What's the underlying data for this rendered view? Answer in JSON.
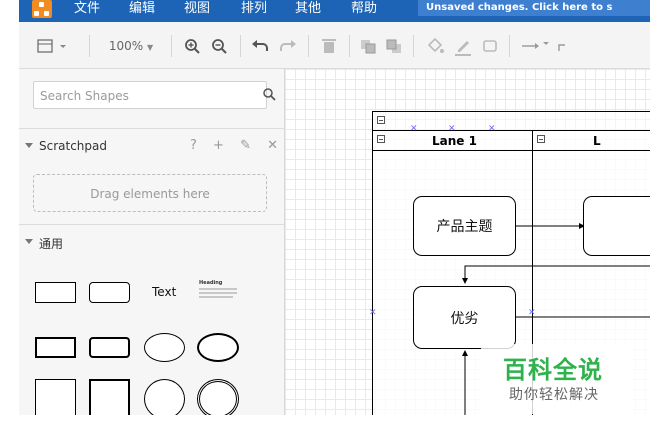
{
  "menubar": {
    "items": [
      "文件",
      "编辑",
      "视图",
      "排列",
      "其他",
      "帮助"
    ],
    "unsaved_notice": "Unsaved changes. Click here to s"
  },
  "toolbar": {
    "zoom": "100%"
  },
  "sidebar": {
    "search_placeholder": "Search Shapes",
    "scratchpad": {
      "title": "Scratchpad",
      "tools": "? + ✎ ✕",
      "drop_hint": "Drag elements here"
    },
    "general": {
      "title": "通用",
      "text_shape": "Text",
      "heading_shape": "Heading"
    }
  },
  "canvas": {
    "lanes": [
      "Lane 1",
      "L"
    ],
    "nodes": [
      "产品主题",
      "优劣"
    ]
  },
  "watermark": {
    "title": "百科全说",
    "subtitle": "助你轻松解决"
  },
  "colors": {
    "menubar": "#1d64b6",
    "logo": "#f28b22",
    "watermark_green": "#2fb24c"
  }
}
